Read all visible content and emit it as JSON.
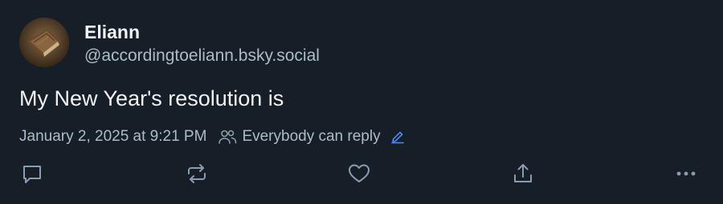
{
  "author": {
    "display_name": "Eliann",
    "handle": "@accordingtoeliann.bsky.social",
    "avatar": "avatar-book-image"
  },
  "post": {
    "text": "My New Year's resolution is",
    "timestamp": "January 2, 2025 at 9:21 PM",
    "reply_setting": "Everybody can reply"
  },
  "icons": {
    "reply": "speech-bubble-icon",
    "repost": "repost-arrows-icon",
    "like": "heart-icon",
    "share": "share-upload-icon",
    "more": "ellipsis-icon",
    "audience": "people-icon",
    "edit": "pencil-icon"
  },
  "colors": {
    "background": "#161e27",
    "primary_text": "#f1f3f5",
    "secondary_text": "#aebbc9",
    "icon": "#8c9cae",
    "accent": "#4d8bf6"
  }
}
